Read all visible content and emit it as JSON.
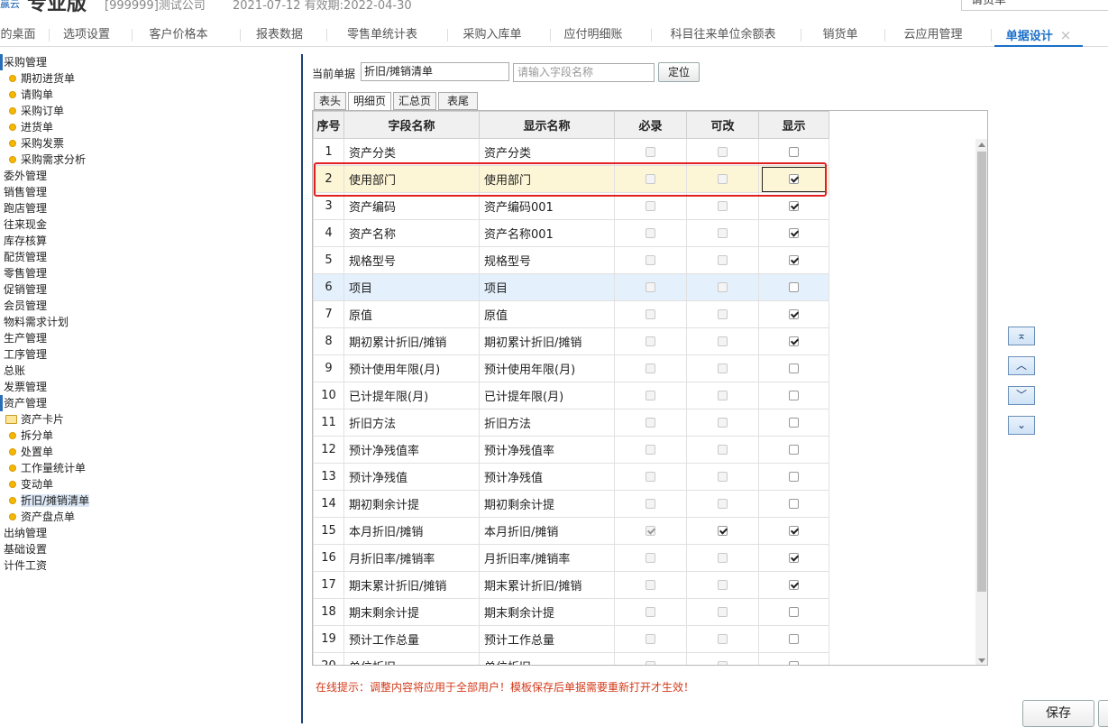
{
  "header": {
    "logo_small": "赢云",
    "edition": "专业版",
    "company": "[999999]测试公司",
    "dates": "2021-07-12   有效期:2022-04-30",
    "search_value": "请货单"
  },
  "tabs": [
    {
      "label": "的桌面"
    },
    {
      "label": "选项设置"
    },
    {
      "label": "客户价格本"
    },
    {
      "label": "报表数据"
    },
    {
      "label": "零售单统计表"
    },
    {
      "label": "采购入库单"
    },
    {
      "label": "应付明细账"
    },
    {
      "label": "科目往来单位余额表"
    },
    {
      "label": "销货单"
    },
    {
      "label": "云应用管理"
    },
    {
      "label": "单据设计",
      "close": "×"
    }
  ],
  "nav": {
    "items": [
      {
        "label": "采购管理",
        "type": "root"
      },
      {
        "label": "期初进货单",
        "type": "child"
      },
      {
        "label": "请购单",
        "type": "child"
      },
      {
        "label": "采购订单",
        "type": "child"
      },
      {
        "label": "进货单",
        "type": "child"
      },
      {
        "label": "采购发票",
        "type": "child"
      },
      {
        "label": "采购需求分析",
        "type": "child"
      },
      {
        "label": "委外管理",
        "type": "root"
      },
      {
        "label": "销售管理",
        "type": "root"
      },
      {
        "label": "跑店管理",
        "type": "root"
      },
      {
        "label": "往来现金",
        "type": "root"
      },
      {
        "label": "库存核算",
        "type": "root"
      },
      {
        "label": "配货管理",
        "type": "root"
      },
      {
        "label": "零售管理",
        "type": "root"
      },
      {
        "label": "促销管理",
        "type": "root"
      },
      {
        "label": "会员管理",
        "type": "root"
      },
      {
        "label": "物料需求计划",
        "type": "root"
      },
      {
        "label": "生产管理",
        "type": "root"
      },
      {
        "label": "工序管理",
        "type": "root"
      },
      {
        "label": "总账",
        "type": "root"
      },
      {
        "label": "发票管理",
        "type": "root"
      },
      {
        "label": "资产管理",
        "type": "root"
      },
      {
        "label": "资产卡片",
        "type": "folder"
      },
      {
        "label": "拆分单",
        "type": "child"
      },
      {
        "label": "处置单",
        "type": "child"
      },
      {
        "label": "工作量统计单",
        "type": "child"
      },
      {
        "label": "变动单",
        "type": "child"
      },
      {
        "label": "折旧/摊销清单",
        "type": "child",
        "selected": true
      },
      {
        "label": "资产盘点单",
        "type": "child"
      },
      {
        "label": "出纳管理",
        "type": "root"
      },
      {
        "label": "基础设置",
        "type": "root"
      },
      {
        "label": "计件工资",
        "type": "root"
      }
    ]
  },
  "form": {
    "current_label": "当前单据",
    "current_value": "折旧/摊销清单",
    "search_placeholder": "请输入字段名称",
    "locate_label": "定位"
  },
  "subtabs": [
    "表头",
    "明细页",
    "汇总页",
    "表尾"
  ],
  "subtab_active": 1,
  "grid": {
    "columns": [
      "序号",
      "字段名称",
      "显示名称",
      "必录",
      "可改",
      "显示"
    ],
    "rows": [
      {
        "no": "1",
        "field": "资产分类",
        "display": "资产分类",
        "required": false,
        "editable": false,
        "show": false
      },
      {
        "no": "2",
        "field": "使用部门",
        "display": "使用部门",
        "required": false,
        "editable": false,
        "show": true,
        "highlight": true
      },
      {
        "no": "3",
        "field": "资产编码",
        "display": "资产编码001",
        "required": false,
        "editable": false,
        "show": true
      },
      {
        "no": "4",
        "field": "资产名称",
        "display": "资产名称001",
        "required": false,
        "editable": false,
        "show": true
      },
      {
        "no": "5",
        "field": "规格型号",
        "display": "规格型号",
        "required": false,
        "editable": false,
        "show": true
      },
      {
        "no": "6",
        "field": "项目",
        "display": "项目",
        "required": false,
        "editable": false,
        "show": false,
        "selected": true
      },
      {
        "no": "7",
        "field": "原值",
        "display": "原值",
        "required": false,
        "editable": false,
        "show": true
      },
      {
        "no": "8",
        "field": "期初累计折旧/摊销",
        "display": "期初累计折旧/摊销",
        "required": false,
        "editable": false,
        "show": true
      },
      {
        "no": "9",
        "field": "预计使用年限(月)",
        "display": "预计使用年限(月)",
        "required": false,
        "editable": false,
        "show": false
      },
      {
        "no": "10",
        "field": "已计提年限(月)",
        "display": "已计提年限(月)",
        "required": false,
        "editable": false,
        "show": false
      },
      {
        "no": "11",
        "field": "折旧方法",
        "display": "折旧方法",
        "required": false,
        "editable": false,
        "show": false
      },
      {
        "no": "12",
        "field": "预计净残值率",
        "display": "预计净残值率",
        "required": false,
        "editable": false,
        "show": false
      },
      {
        "no": "13",
        "field": "预计净残值",
        "display": "预计净残值",
        "required": false,
        "editable": false,
        "show": false
      },
      {
        "no": "14",
        "field": "期初剩余计提",
        "display": "期初剩余计提",
        "required": false,
        "editable": false,
        "show": false
      },
      {
        "no": "15",
        "field": "本月折旧/摊销",
        "display": "本月折旧/摊销",
        "required": true,
        "editable": true,
        "show": true
      },
      {
        "no": "16",
        "field": "月折旧率/摊销率",
        "display": "月折旧率/摊销率",
        "required": false,
        "editable": false,
        "show": true
      },
      {
        "no": "17",
        "field": "期末累计折旧/摊销",
        "display": "期末累计折旧/摊销",
        "required": false,
        "editable": false,
        "show": true
      },
      {
        "no": "18",
        "field": "期末剩余计提",
        "display": "期末剩余计提",
        "required": false,
        "editable": false,
        "show": false
      },
      {
        "no": "19",
        "field": "预计工作总量",
        "display": "预计工作总量",
        "required": false,
        "editable": false,
        "show": false
      },
      {
        "no": "20",
        "field": "单位折旧",
        "display": "单位折旧",
        "required": false,
        "editable": false,
        "show": false
      }
    ]
  },
  "move_buttons": [
    {
      "name": "move-top-button",
      "glyph": "⌅"
    },
    {
      "name": "move-up-button",
      "glyph": "︿"
    },
    {
      "name": "move-down-button",
      "glyph": "﹀"
    },
    {
      "name": "move-bottom-button",
      "glyph": "⌄"
    }
  ],
  "tip": "在线提示：调整内容将应用于全部用户！模板保存后单据需要重新打开才生效！",
  "save_label": "保存",
  "colors": {
    "accent": "#1a6fc8",
    "highlight_border": "#e02020",
    "tip": "#d23a1a"
  }
}
